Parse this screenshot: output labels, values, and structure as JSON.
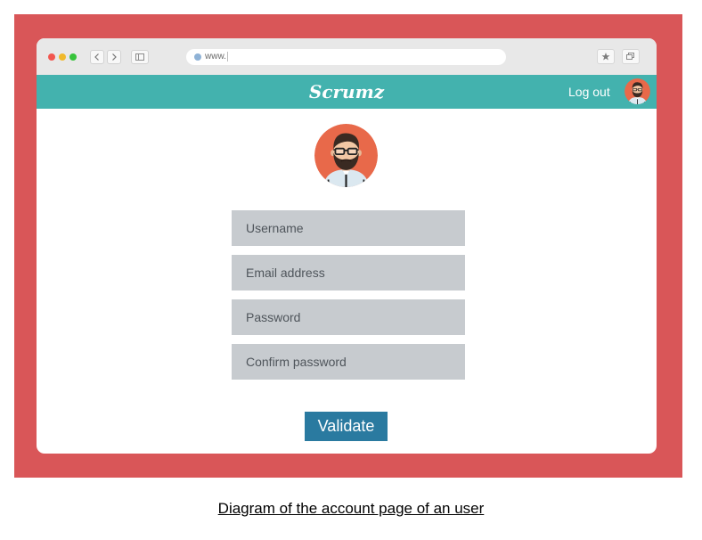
{
  "colors": {
    "frame": "#d95658",
    "appbar": "#43b2ae",
    "field": "#c7cbcf",
    "validate_button": "#2a7aa0",
    "avatar_background": "#e8694a"
  },
  "browser": {
    "url": "www.",
    "icons": {
      "back": "chevron-left-icon",
      "forward": "chevron-right-icon",
      "sidebar": "sidebar-icon",
      "bookmark": "star-icon",
      "tabs": "tabs-icon"
    }
  },
  "appbar": {
    "brand": "Scrumz",
    "logout_label": "Log out"
  },
  "form": {
    "username_placeholder": "Username",
    "email_placeholder": "Email address",
    "password_placeholder": "Password",
    "confirm_placeholder": "Confirm password",
    "submit_label": "Validate"
  },
  "caption": "Diagram of the account page of an user"
}
